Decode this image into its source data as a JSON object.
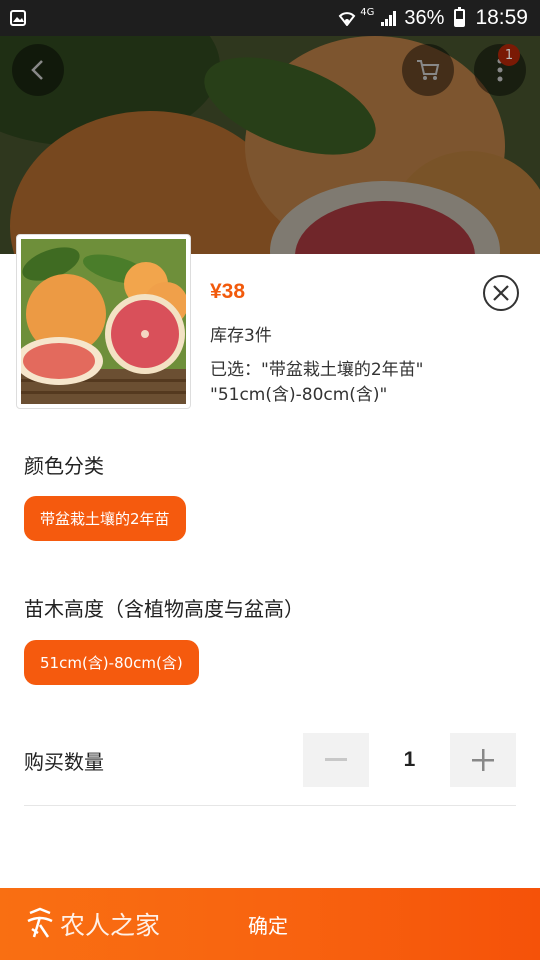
{
  "status_bar": {
    "network": "4G",
    "battery_percent": "36%",
    "time": "18:59"
  },
  "top_bar": {
    "cart_badge_count": "1"
  },
  "product": {
    "price": "¥38",
    "stock": "库存3件",
    "selected_line1": "已选：\"带盆栽土壤的2年苗\"",
    "selected_line2": "\"51cm(含)-80cm(含)\""
  },
  "options": {
    "color": {
      "title": "颜色分类",
      "selected": "带盆栽土壤的2年苗"
    },
    "height": {
      "title": "苗木高度（含植物高度与盆高）",
      "selected": "51cm(含)-80cm(含)"
    }
  },
  "quantity": {
    "label": "购买数量",
    "value": "1"
  },
  "footer": {
    "confirm_label": "确定",
    "watermark": "农人之家"
  },
  "colors": {
    "accent": "#f55a0e",
    "price": "#f25a0c"
  }
}
